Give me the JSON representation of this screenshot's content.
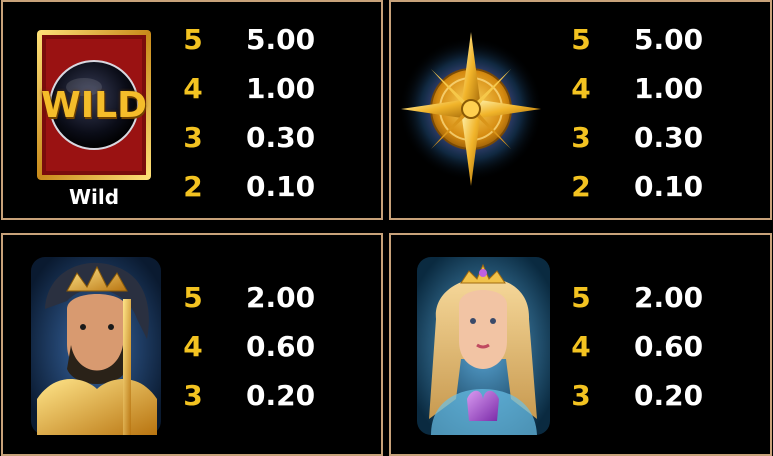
{
  "paytable": [
    {
      "symbol": "wild-symbol",
      "symbol_text": "WILD",
      "label": "Wild",
      "pays": [
        {
          "count": "5",
          "value": "5.00"
        },
        {
          "count": "4",
          "value": "1.00"
        },
        {
          "count": "3",
          "value": "0.30"
        },
        {
          "count": "2",
          "value": "0.10"
        }
      ]
    },
    {
      "symbol": "compass-symbol",
      "pays": [
        {
          "count": "5",
          "value": "5.00"
        },
        {
          "count": "4",
          "value": "1.00"
        },
        {
          "count": "3",
          "value": "0.30"
        },
        {
          "count": "2",
          "value": "0.10"
        }
      ]
    },
    {
      "symbol": "poseidon-symbol",
      "pays": [
        {
          "count": "5",
          "value": "2.00"
        },
        {
          "count": "4",
          "value": "0.60"
        },
        {
          "count": "3",
          "value": "0.20"
        }
      ]
    },
    {
      "symbol": "mermaid-symbol",
      "pays": [
        {
          "count": "5",
          "value": "2.00"
        },
        {
          "count": "4",
          "value": "0.60"
        },
        {
          "count": "3",
          "value": "0.20"
        }
      ]
    }
  ],
  "colors": {
    "panel_border": "#c8a27a",
    "count_color": "#f3c321",
    "value_color": "#ffffff",
    "background": "#000000"
  }
}
